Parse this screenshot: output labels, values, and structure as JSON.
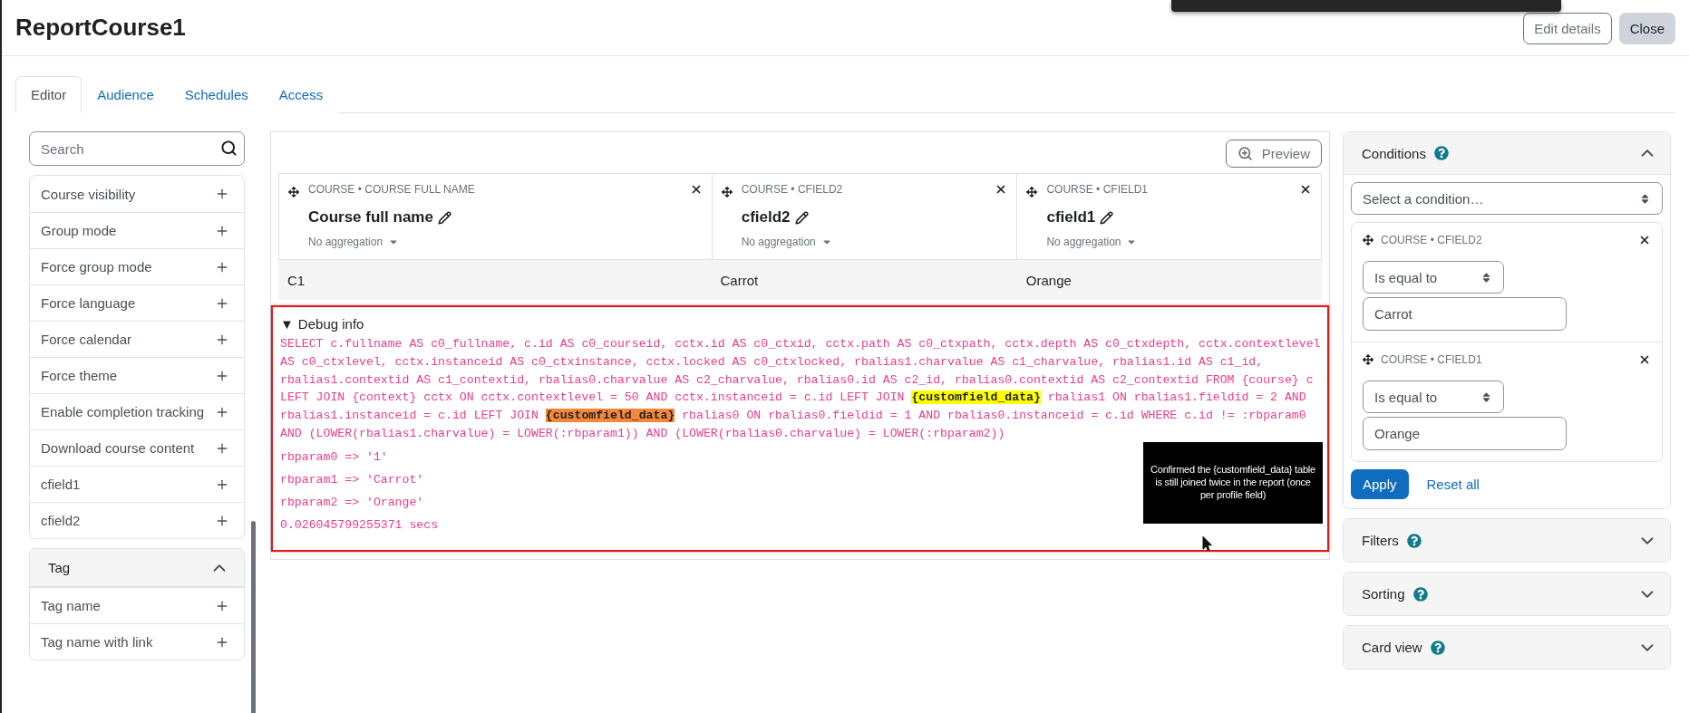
{
  "page": {
    "title": "ReportCourse1",
    "buttons": [
      {
        "label": "Edit details",
        "kind": "outline"
      },
      {
        "label": "Close",
        "kind": "secondary"
      }
    ]
  },
  "tabs": [
    {
      "label": "Editor",
      "selected": true
    },
    {
      "label": "Audience",
      "selected": false
    },
    {
      "label": "Schedules",
      "selected": false
    },
    {
      "label": "Access",
      "selected": false
    }
  ],
  "sidebar": {
    "search": {
      "placeholder": "Search"
    },
    "items": [
      "Course visibility",
      "Group mode",
      "Force group mode",
      "Force language",
      "Force calendar",
      "Force theme",
      "Enable completion tracking",
      "Download course content",
      "cfield1",
      "cfield2"
    ],
    "sections": [
      {
        "title": "Tag",
        "expanded": true,
        "items": [
          "Tag name",
          "Tag name with link"
        ]
      }
    ]
  },
  "preview_button": "Preview",
  "columns": [
    {
      "source": "COURSE • COURSE FULL NAME",
      "title": "Course full name",
      "aggregation": "No aggregation"
    },
    {
      "source": "COURSE • CFIELD2",
      "title": "cfield2",
      "aggregation": "No aggregation"
    },
    {
      "source": "COURSE • CFIELD1",
      "title": "cfield1",
      "aggregation": "No aggregation"
    }
  ],
  "rows": [
    [
      "C1",
      "Carrot",
      "Orange"
    ]
  ],
  "debug": {
    "marker": "▼",
    "title": "Debug info",
    "expanded": true,
    "sql": [
      {
        "text": "SELECT c.fullname AS c0_fullname, c.id AS c0_courseid, cctx.id AS c0_ctxid, cctx.path AS c0_ctxpath, cctx.depth AS c0_ctxdepth, cctx.contextlevel AS c0_ctxlevel, cctx.instanceid AS c0_ctxinstance, cctx.locked AS c0_ctxlocked, rbalias1.charvalue AS c1_charvalue, rbalias1.id AS c1_id, rbalias1.contextid AS c1_contextid, rbalias0.charvalue AS c2_charvalue, rbalias0.id AS c2_id, rbalias0.contextid AS c2_contextid FROM {course} c LEFT JOIN {context} cctx ON cctx.contextlevel = 50 AND cctx.instanceid = c.id LEFT JOIN "
      },
      {
        "text": "{customfield_data}",
        "color": "#ffff00"
      },
      {
        "text": " rbalias1 ON rbalias1.fieldid = 2 AND rbalias1.instanceid = c.id LEFT JOIN "
      },
      {
        "text": "{customfield_data}",
        "color": "#f5883a"
      },
      {
        "text": " rbalias0 ON rbalias0.fieldid = 1 AND rbalias0.instanceid = c.id WHERE c.id != :rbparam0 AND (LOWER(rbalias1.charvalue) = LOWER(:rbparam1)) AND (LOWER(rbalias0.charvalue) = LOWER(:rbparam2))"
      }
    ],
    "params": [
      "rbparam0 => '1'",
      "rbparam1 => 'Carrot'",
      "rbparam2 => 'Orange'"
    ],
    "time": "0.026045799255371 secs"
  },
  "annotation": "Confirmed the {customfield_data} table is still joined twice in the report (once per profile field)",
  "conditions": {
    "title": "Conditions",
    "expanded": true,
    "select_placeholder": "Select a condition…",
    "items": [
      {
        "source": "COURSE • CFIELD2",
        "operator": "Is equal to",
        "value": "Carrot"
      },
      {
        "source": "COURSE • CFIELD1",
        "operator": "Is equal to",
        "value": "Orange"
      }
    ],
    "apply": "Apply",
    "reset": "Reset all"
  },
  "panels": [
    {
      "title": "Filters",
      "expanded": false
    },
    {
      "title": "Sorting",
      "expanded": false
    },
    {
      "title": "Card view",
      "expanded": false
    }
  ]
}
